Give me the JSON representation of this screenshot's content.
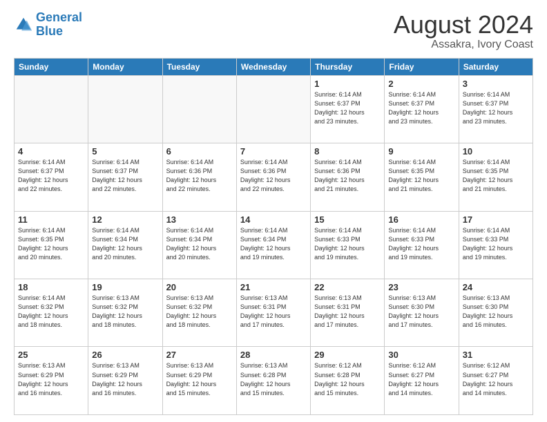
{
  "logo": {
    "line1": "General",
    "line2": "Blue"
  },
  "title": "August 2024",
  "subtitle": "Assakra, Ivory Coast",
  "days_of_week": [
    "Sunday",
    "Monday",
    "Tuesday",
    "Wednesday",
    "Thursday",
    "Friday",
    "Saturday"
  ],
  "weeks": [
    [
      {
        "day": "",
        "info": ""
      },
      {
        "day": "",
        "info": ""
      },
      {
        "day": "",
        "info": ""
      },
      {
        "day": "",
        "info": ""
      },
      {
        "day": "1",
        "info": "Sunrise: 6:14 AM\nSunset: 6:37 PM\nDaylight: 12 hours\nand 23 minutes."
      },
      {
        "day": "2",
        "info": "Sunrise: 6:14 AM\nSunset: 6:37 PM\nDaylight: 12 hours\nand 23 minutes."
      },
      {
        "day": "3",
        "info": "Sunrise: 6:14 AM\nSunset: 6:37 PM\nDaylight: 12 hours\nand 23 minutes."
      }
    ],
    [
      {
        "day": "4",
        "info": "Sunrise: 6:14 AM\nSunset: 6:37 PM\nDaylight: 12 hours\nand 22 minutes."
      },
      {
        "day": "5",
        "info": "Sunrise: 6:14 AM\nSunset: 6:37 PM\nDaylight: 12 hours\nand 22 minutes."
      },
      {
        "day": "6",
        "info": "Sunrise: 6:14 AM\nSunset: 6:36 PM\nDaylight: 12 hours\nand 22 minutes."
      },
      {
        "day": "7",
        "info": "Sunrise: 6:14 AM\nSunset: 6:36 PM\nDaylight: 12 hours\nand 22 minutes."
      },
      {
        "day": "8",
        "info": "Sunrise: 6:14 AM\nSunset: 6:36 PM\nDaylight: 12 hours\nand 21 minutes."
      },
      {
        "day": "9",
        "info": "Sunrise: 6:14 AM\nSunset: 6:35 PM\nDaylight: 12 hours\nand 21 minutes."
      },
      {
        "day": "10",
        "info": "Sunrise: 6:14 AM\nSunset: 6:35 PM\nDaylight: 12 hours\nand 21 minutes."
      }
    ],
    [
      {
        "day": "11",
        "info": "Sunrise: 6:14 AM\nSunset: 6:35 PM\nDaylight: 12 hours\nand 20 minutes."
      },
      {
        "day": "12",
        "info": "Sunrise: 6:14 AM\nSunset: 6:34 PM\nDaylight: 12 hours\nand 20 minutes."
      },
      {
        "day": "13",
        "info": "Sunrise: 6:14 AM\nSunset: 6:34 PM\nDaylight: 12 hours\nand 20 minutes."
      },
      {
        "day": "14",
        "info": "Sunrise: 6:14 AM\nSunset: 6:34 PM\nDaylight: 12 hours\nand 19 minutes."
      },
      {
        "day": "15",
        "info": "Sunrise: 6:14 AM\nSunset: 6:33 PM\nDaylight: 12 hours\nand 19 minutes."
      },
      {
        "day": "16",
        "info": "Sunrise: 6:14 AM\nSunset: 6:33 PM\nDaylight: 12 hours\nand 19 minutes."
      },
      {
        "day": "17",
        "info": "Sunrise: 6:14 AM\nSunset: 6:33 PM\nDaylight: 12 hours\nand 19 minutes."
      }
    ],
    [
      {
        "day": "18",
        "info": "Sunrise: 6:14 AM\nSunset: 6:32 PM\nDaylight: 12 hours\nand 18 minutes."
      },
      {
        "day": "19",
        "info": "Sunrise: 6:13 AM\nSunset: 6:32 PM\nDaylight: 12 hours\nand 18 minutes."
      },
      {
        "day": "20",
        "info": "Sunrise: 6:13 AM\nSunset: 6:32 PM\nDaylight: 12 hours\nand 18 minutes."
      },
      {
        "day": "21",
        "info": "Sunrise: 6:13 AM\nSunset: 6:31 PM\nDaylight: 12 hours\nand 17 minutes."
      },
      {
        "day": "22",
        "info": "Sunrise: 6:13 AM\nSunset: 6:31 PM\nDaylight: 12 hours\nand 17 minutes."
      },
      {
        "day": "23",
        "info": "Sunrise: 6:13 AM\nSunset: 6:30 PM\nDaylight: 12 hours\nand 17 minutes."
      },
      {
        "day": "24",
        "info": "Sunrise: 6:13 AM\nSunset: 6:30 PM\nDaylight: 12 hours\nand 16 minutes."
      }
    ],
    [
      {
        "day": "25",
        "info": "Sunrise: 6:13 AM\nSunset: 6:29 PM\nDaylight: 12 hours\nand 16 minutes."
      },
      {
        "day": "26",
        "info": "Sunrise: 6:13 AM\nSunset: 6:29 PM\nDaylight: 12 hours\nand 16 minutes."
      },
      {
        "day": "27",
        "info": "Sunrise: 6:13 AM\nSunset: 6:29 PM\nDaylight: 12 hours\nand 15 minutes."
      },
      {
        "day": "28",
        "info": "Sunrise: 6:13 AM\nSunset: 6:28 PM\nDaylight: 12 hours\nand 15 minutes."
      },
      {
        "day": "29",
        "info": "Sunrise: 6:12 AM\nSunset: 6:28 PM\nDaylight: 12 hours\nand 15 minutes."
      },
      {
        "day": "30",
        "info": "Sunrise: 6:12 AM\nSunset: 6:27 PM\nDaylight: 12 hours\nand 14 minutes."
      },
      {
        "day": "31",
        "info": "Sunrise: 6:12 AM\nSunset: 6:27 PM\nDaylight: 12 hours\nand 14 minutes."
      }
    ]
  ]
}
